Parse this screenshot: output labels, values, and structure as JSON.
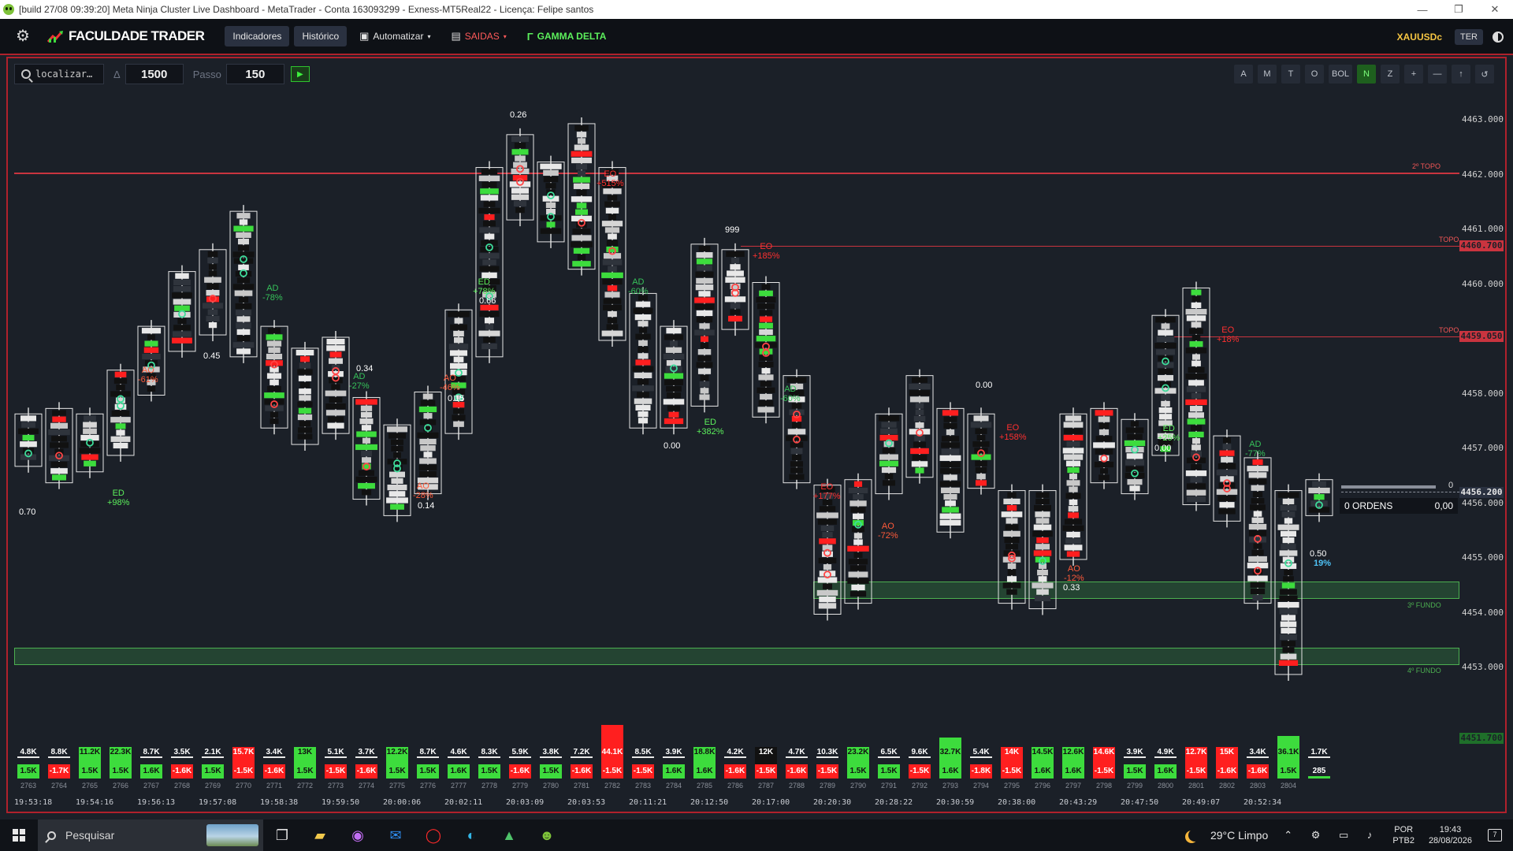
{
  "window": {
    "title": "[build 27/08 09:39:20]  Meta Ninja Cluster Live Dashboard - MetaTrader - Conta 163093299 - Exness-MT5Real22 - Licença: Felipe santos",
    "minimize": "—",
    "maximize": "❐",
    "close": "✕"
  },
  "toolbar": {
    "gear_icon": "gear-icon",
    "brand": "FACULDADE TRADER",
    "indicadores": "Indicadores",
    "historico": "Histórico",
    "automatizar": "Automatizar",
    "saidas": "SAIDAS",
    "gamma": "GAMMA DELTA",
    "symbol": "XAUUSDc",
    "session": "TER",
    "caret": "▾",
    "gamma_mark": "Γ"
  },
  "controls": {
    "search_value": "localizar…",
    "delta_label": "Δ",
    "delta_value": "1500",
    "step_label": "Passo",
    "step_value": "150",
    "play": "▶",
    "modes": [
      "A",
      "M",
      "T",
      "O",
      "BOL",
      "N",
      "Z",
      "+",
      "—",
      "↑",
      "↺"
    ],
    "active_mode": "N"
  },
  "price_axis": {
    "ticks": [
      "4463.000",
      "4462.000",
      "4461.000",
      "4460.000",
      "4459.000",
      "4458.000",
      "4457.000",
      "4456.000",
      "4455.000",
      "4454.000",
      "4453.000"
    ],
    "tag_top": "4460.700",
    "tag_topo": "4459.050",
    "tag_current": "4456.200",
    "tag_bottom": "4451.700"
  },
  "levels": {
    "top2": "2º TOPO",
    "topo1": "TOPO",
    "topo2": "TOPO",
    "fundo3": "3º FUNDO",
    "fundo4": "4º FUNDO",
    "current_zero": "0"
  },
  "orders": {
    "label": "0 ORDENS",
    "value": "0,00"
  },
  "annotations": [
    {
      "t": "ED\n+98%",
      "c": "#5cf05c"
    },
    {
      "t": "AO\n-61%",
      "c": "#ff5a3a"
    },
    {
      "t": "AD\n-78%",
      "c": "#36c25a"
    },
    {
      "t": "AD\n-27%",
      "c": "#36c25a"
    },
    {
      "t": "AO\n-28%",
      "c": "#ff5a3a"
    },
    {
      "t": "AO\n-46%",
      "c": "#ff5a3a"
    },
    {
      "t": "ED\n+78%",
      "c": "#5cf05c"
    },
    {
      "t": "EO\n+515%",
      "c": "#ff3030"
    },
    {
      "t": "AD\n-60%",
      "c": "#36c25a"
    },
    {
      "t": "ED\n+382%",
      "c": "#5cf05c"
    },
    {
      "t": "EO\n+185%",
      "c": "#ff3030"
    },
    {
      "t": "AD\n-60%",
      "c": "#36c25a"
    },
    {
      "t": "EO\n+177%",
      "c": "#ff3030"
    },
    {
      "t": "AO\n-72%",
      "c": "#ff5a3a"
    },
    {
      "t": "EO\n+158%",
      "c": "#ff3030"
    },
    {
      "t": "AO\n-12%",
      "c": "#ff5a3a"
    },
    {
      "t": "ED\n+25%",
      "c": "#5cf05c"
    },
    {
      "t": "EO\n+18%",
      "c": "#ff3030"
    },
    {
      "t": "AD\n-77%",
      "c": "#36c25a"
    }
  ],
  "value_labels": [
    "0.70",
    "0.45",
    "0.34",
    "0.15",
    "0.14",
    "0.26",
    "0.66",
    "999",
    "0.00",
    "0.00",
    "0.33",
    "0.00",
    "0.50"
  ],
  "current_pct": "19%",
  "volume": {
    "top": [
      "4.8K",
      "8.8K",
      "11.2K",
      "22.3K",
      "8.7K",
      "3.5K",
      "2.1K",
      "15.7K",
      "3.4K",
      "13K",
      "5.1K",
      "3.7K",
      "12.2K",
      "8.7K",
      "4.6K",
      "8.3K",
      "5.9K",
      "3.8K",
      "7.2K",
      "44.1K",
      "8.5K",
      "3.9K",
      "18.8K",
      "4.2K",
      "12K",
      "4.7K",
      "10.3K",
      "23.2K",
      "6.5K",
      "9.6K",
      "32.7K",
      "5.4K",
      "14K",
      "14.5K",
      "12.6K",
      "14.6K",
      "3.9K",
      "4.9K",
      "12.7K",
      "15K",
      "3.4K",
      "36.1K",
      "1.7K"
    ],
    "top_color": [
      "w",
      "w",
      "g",
      "g",
      "w",
      "w",
      "w",
      "r",
      "w",
      "g",
      "w",
      "w",
      "g",
      "w",
      "w",
      "w",
      "w",
      "w",
      "w",
      "r",
      "w",
      "w",
      "g",
      "w",
      "k",
      "w",
      "w",
      "g",
      "w",
      "w",
      "g",
      "w",
      "r",
      "g",
      "g",
      "r",
      "w",
      "w",
      "r",
      "r",
      "w",
      "g",
      "w"
    ],
    "top_level": [
      0.05,
      0.05,
      0.05,
      0.3,
      0.05,
      0.05,
      0.05,
      0.2,
      0.05,
      0.1,
      0.05,
      0.05,
      0.05,
      0.05,
      0.05,
      0.05,
      0.05,
      0.05,
      0.05,
      0.95,
      0.05,
      0.05,
      0.25,
      0.05,
      0.05,
      0.05,
      0.05,
      0.35,
      0.05,
      0.05,
      0.6,
      0.05,
      0.1,
      0.12,
      0.12,
      0.12,
      0.05,
      0.05,
      0.12,
      0.15,
      0.05,
      0.65,
      0.05
    ],
    "delta": [
      "1.5K",
      "-1.7K",
      "1.5K",
      "1.5K",
      "1.6K",
      "-1.6K",
      "1.5K",
      "-1.5K",
      "-1.6K",
      "1.5K",
      "-1.5K",
      "-1.6K",
      "1.5K",
      "1.5K",
      "1.6K",
      "1.5K",
      "-1.6K",
      "1.5K",
      "-1.6K",
      "-1.5K",
      "-1.5K",
      "1.6K",
      "1.6K",
      "-1.6K",
      "-1.5K",
      "-1.6K",
      "-1.5K",
      "1.5K",
      "1.5K",
      "-1.5K",
      "1.6K",
      "-1.8K",
      "-1.5K",
      "1.6K",
      "1.6K",
      "-1.5K",
      "1.5K",
      "1.6K",
      "-1.5K",
      "-1.6K",
      "-1.6K",
      "1.5K",
      "285"
    ],
    "index": [
      "2763",
      "2764",
      "2765",
      "2766",
      "2767",
      "2768",
      "2769",
      "2770",
      "2771",
      "2772",
      "2773",
      "2774",
      "2775",
      "2776",
      "2777",
      "2778",
      "2779",
      "2780",
      "2781",
      "2782",
      "2783",
      "2784",
      "2785",
      "2786",
      "2787",
      "2788",
      "2789",
      "2790",
      "2791",
      "2792",
      "2793",
      "2794",
      "2795",
      "2796",
      "2797",
      "2798",
      "2799",
      "2800",
      "2801",
      "2802",
      "2803",
      "2804",
      ""
    ],
    "times": [
      "19:53:18",
      "19:54:16",
      "19:56:13",
      "19:57:08",
      "19:58:38",
      "19:59:50",
      "20:00:06",
      "20:02:11",
      "20:03:09",
      "20:03:53",
      "20:11:21",
      "20:12:50",
      "20:17:00",
      "20:20:30",
      "20:28:22",
      "20:30:59",
      "20:38:00",
      "20:43:29",
      "20:47:50",
      "20:49:07",
      "20:52:34"
    ]
  },
  "candles": [
    {
      "lo": 4456.7,
      "hi": 4457.6,
      "d": "g"
    },
    {
      "lo": 4456.4,
      "hi": 4457.7,
      "d": "r"
    },
    {
      "lo": 4456.6,
      "hi": 4457.6,
      "d": "g"
    },
    {
      "lo": 4456.9,
      "hi": 4458.4,
      "d": "g"
    },
    {
      "lo": 4458.0,
      "hi": 4459.2,
      "d": "g"
    },
    {
      "lo": 4458.8,
      "hi": 4460.2,
      "d": "g"
    },
    {
      "lo": 4459.1,
      "hi": 4460.6,
      "d": "r"
    },
    {
      "lo": 4458.7,
      "hi": 4461.3,
      "d": "g"
    },
    {
      "lo": 4457.4,
      "hi": 4459.2,
      "d": "r"
    },
    {
      "lo": 4457.1,
      "hi": 4458.8,
      "d": "g"
    },
    {
      "lo": 4457.3,
      "hi": 4459.0,
      "d": "r"
    },
    {
      "lo": 4456.1,
      "hi": 4457.9,
      "d": "r"
    },
    {
      "lo": 4455.8,
      "hi": 4457.4,
      "d": "g"
    },
    {
      "lo": 4456.2,
      "hi": 4458.0,
      "d": "g"
    },
    {
      "lo": 4457.3,
      "hi": 4459.5,
      "d": "g"
    },
    {
      "lo": 4458.7,
      "hi": 4462.1,
      "d": "g"
    },
    {
      "lo": 4461.2,
      "hi": 4462.7,
      "d": "r"
    },
    {
      "lo": 4460.8,
      "hi": 4462.2,
      "d": "g"
    },
    {
      "lo": 4460.3,
      "hi": 4462.9,
      "d": "r"
    },
    {
      "lo": 4459.0,
      "hi": 4462.1,
      "d": "r"
    },
    {
      "lo": 4457.4,
      "hi": 4459.8,
      "d": "r"
    },
    {
      "lo": 4457.4,
      "hi": 4459.2,
      "d": "g"
    },
    {
      "lo": 4457.8,
      "hi": 4460.7,
      "d": "g"
    },
    {
      "lo": 4459.2,
      "hi": 4460.6,
      "d": "r"
    },
    {
      "lo": 4457.6,
      "hi": 4460.0,
      "d": "r"
    },
    {
      "lo": 4456.4,
      "hi": 4458.3,
      "d": "r"
    },
    {
      "lo": 4454.0,
      "hi": 4456.3,
      "d": "r"
    },
    {
      "lo": 4454.2,
      "hi": 4456.4,
      "d": "g"
    },
    {
      "lo": 4456.2,
      "hi": 4457.6,
      "d": "g"
    },
    {
      "lo": 4456.5,
      "hi": 4458.3,
      "d": "r"
    },
    {
      "lo": 4455.5,
      "hi": 4457.7,
      "d": "g"
    },
    {
      "lo": 4456.3,
      "hi": 4457.6,
      "d": "r"
    },
    {
      "lo": 4454.2,
      "hi": 4456.2,
      "d": "r"
    },
    {
      "lo": 4454.1,
      "hi": 4456.2,
      "d": "g"
    },
    {
      "lo": 4455.0,
      "hi": 4457.6,
      "d": "g"
    },
    {
      "lo": 4456.4,
      "hi": 4457.7,
      "d": "r"
    },
    {
      "lo": 4456.2,
      "hi": 4457.5,
      "d": "g"
    },
    {
      "lo": 4456.9,
      "hi": 4459.4,
      "d": "g"
    },
    {
      "lo": 4456.0,
      "hi": 4459.9,
      "d": "r"
    },
    {
      "lo": 4455.7,
      "hi": 4457.2,
      "d": "r"
    },
    {
      "lo": 4454.2,
      "hi": 4456.8,
      "d": "r"
    },
    {
      "lo": 4452.9,
      "hi": 4456.2,
      "d": "g"
    },
    {
      "lo": 4455.8,
      "hi": 4456.4,
      "d": "g"
    }
  ],
  "taskbar": {
    "search": "Pesquisar",
    "weather": "29°C  Limpo",
    "lang1": "POR",
    "lang2": "PTB2",
    "time": "19:43",
    "date": "28/08/2026",
    "notif": "7",
    "tray_icons": "⌃ ⚙ ▭ ♪"
  }
}
